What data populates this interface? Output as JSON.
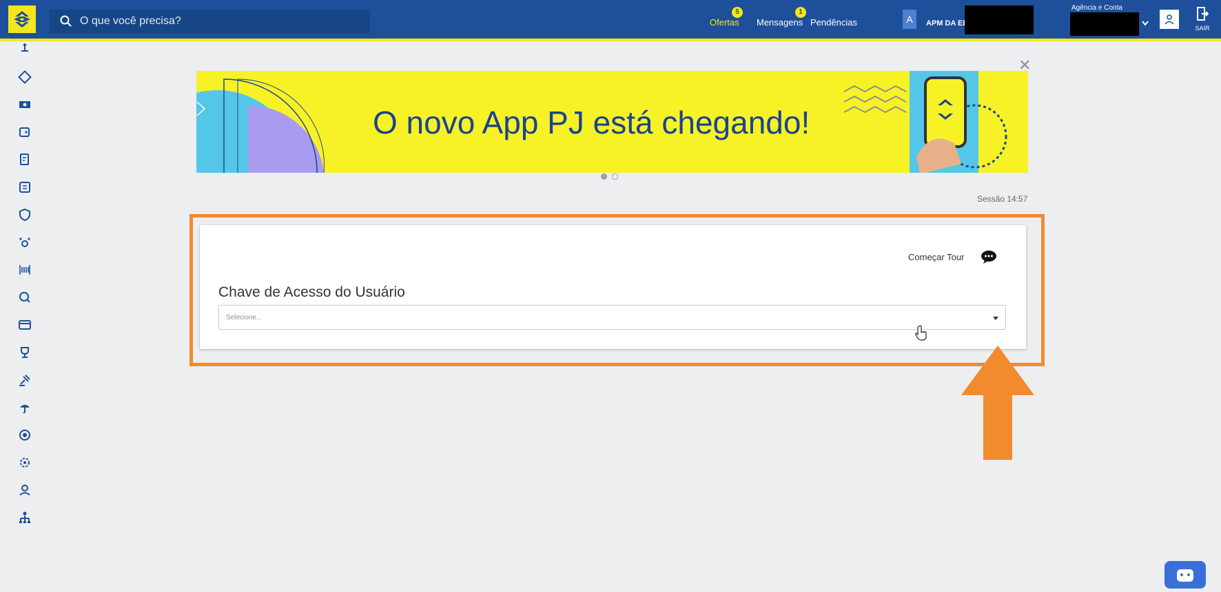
{
  "header": {
    "search_placeholder": "O que você precisa?",
    "nav": [
      {
        "label": "Ofertas",
        "badge": "5",
        "active": true
      },
      {
        "label": "Mensagens",
        "badge": "1",
        "active": false
      },
      {
        "label": "Pendências",
        "badge": "",
        "active": false
      }
    ],
    "account_initial": "A",
    "account_name": "APM DA EE",
    "agency_label": "Agência e Conta",
    "exit_label": "SAIR"
  },
  "sidebar_icons": [
    "transfer-icon",
    "cards-icon",
    "cash-icon",
    "wallet-icon",
    "statement-icon",
    "transfers-box-icon",
    "shield-money-icon",
    "network-icon",
    "barcode-icon",
    "investment-icon",
    "card-icon",
    "trophy-icon",
    "auction-icon",
    "umbrella-icon",
    "security-icon",
    "settings-money-icon",
    "hand-money-icon",
    "hierarchy-icon"
  ],
  "banner": {
    "headline": "O novo App PJ está chegando!",
    "slide_count": 2,
    "active_slide": 1
  },
  "session_label": "Sessão 14:57",
  "card": {
    "tour_label": "Começar Tour",
    "title": "Chave de Acesso do Usuário",
    "select_placeholder": "Selecione..."
  },
  "colors": {
    "brand_blue": "#1d4f9a",
    "brand_yellow": "#f5e61b",
    "highlight_orange": "#f28a2e"
  }
}
